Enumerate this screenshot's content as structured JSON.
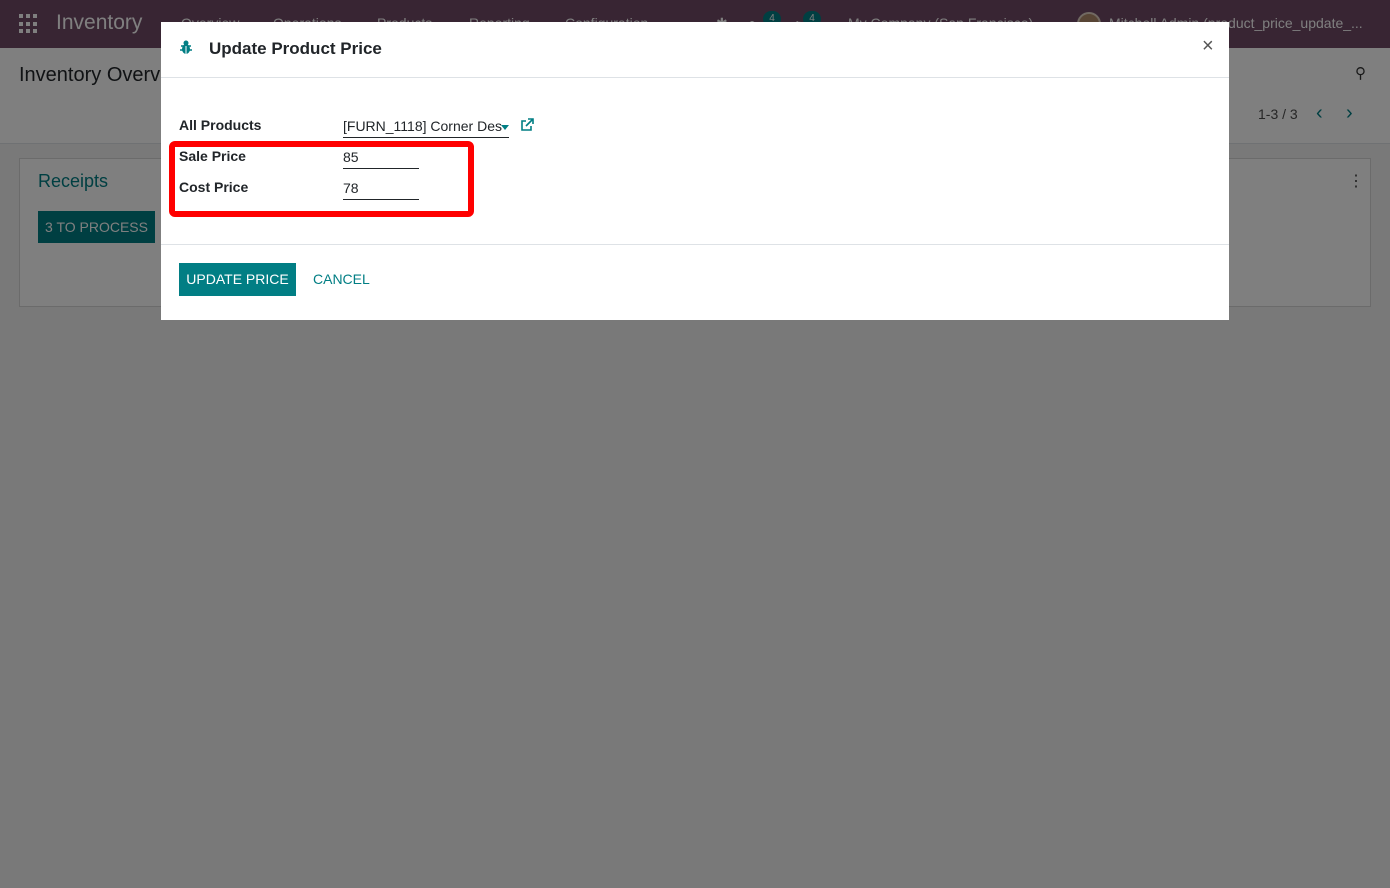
{
  "navbar": {
    "app_name": "Inventory",
    "menu": [
      "Overview",
      "Operations",
      "Products",
      "Reporting",
      "Configuration"
    ],
    "messages_badge": "4",
    "activities_badge": "4",
    "company": "My Company (San Francisco)",
    "user": "Mitchell Admin (product_price_update_..."
  },
  "control_panel": {
    "breadcrumb": "Inventory Overview",
    "pager": "1-3 / 3",
    "pager_prev": "‹",
    "pager_next": "›"
  },
  "card": {
    "title": "Receipts",
    "button": "3 TO PROCESS"
  },
  "dialog": {
    "title": "Update Product Price",
    "close": "×",
    "fields": {
      "product_label": "All Products",
      "product_value": "[FURN_1118] Corner Des",
      "sale_label": "Sale Price",
      "sale_value": "85",
      "cost_label": "Cost Price",
      "cost_value": "78"
    },
    "buttons": {
      "update": "UPDATE PRICE",
      "cancel": "CANCEL"
    }
  },
  "colors": {
    "navbar": "#714b67",
    "primary": "#017e84",
    "highlight": "#ff0000"
  }
}
